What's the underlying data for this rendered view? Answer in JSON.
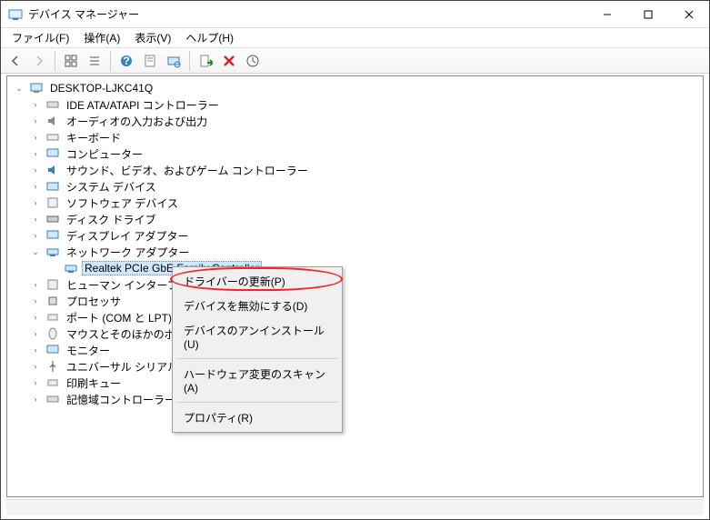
{
  "window": {
    "title": "デバイス マネージャー"
  },
  "menu": {
    "file": "ファイル(F)",
    "action": "操作(A)",
    "view": "表示(V)",
    "help": "ヘルプ(H)"
  },
  "tree": {
    "root": "DESKTOP-LJKC41Q",
    "items": [
      "IDE ATA/ATAPI コントローラー",
      "オーディオの入力および出力",
      "キーボード",
      "コンピューター",
      "サウンド、ビデオ、およびゲーム コントローラー",
      "システム デバイス",
      "ソフトウェア デバイス",
      "ディスク ドライブ",
      "ディスプレイ アダプター",
      "ネットワーク アダプター",
      "ヒューマン インターフェイ",
      "プロセッサ",
      "ポート (COM と LPT)",
      "マウスとそのほかのポイ",
      "モニター",
      "ユニバーサル シリアル ノ",
      "印刷キュー",
      "記憶域コントローラー"
    ],
    "selected_device": "Realtek PCIe GbE Family Controller"
  },
  "context": {
    "update": "ドライバーの更新(P)",
    "disable": "デバイスを無効にする(D)",
    "uninstall": "デバイスのアンインストール(U)",
    "scan": "ハードウェア変更のスキャン(A)",
    "properties": "プロパティ(R)"
  }
}
